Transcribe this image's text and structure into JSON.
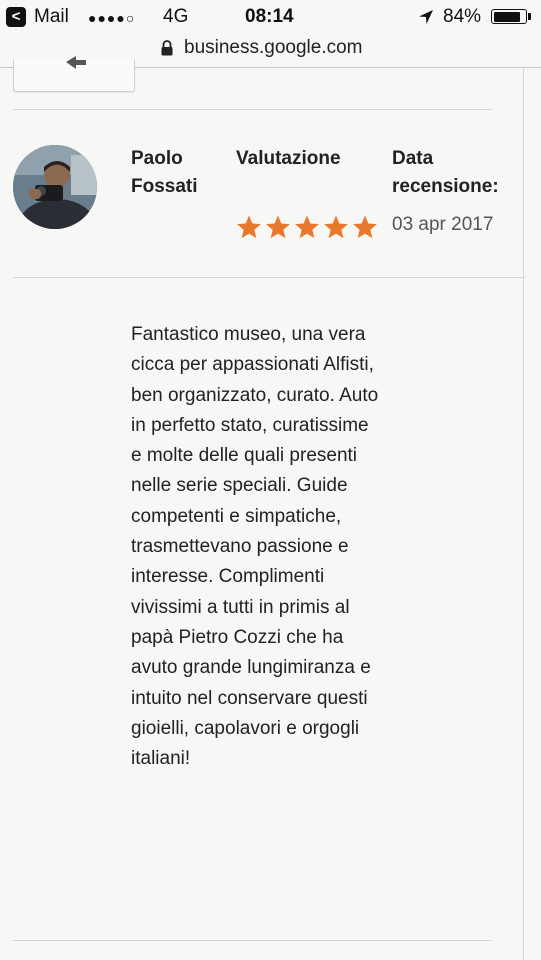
{
  "status_bar": {
    "back_glyph": "<",
    "app": "Mail",
    "signal": "●●●●○",
    "network": "4G",
    "time": "08:14",
    "battery": "84%",
    "battery_level": 0.84
  },
  "url_bar": {
    "url": "business.google.com",
    "icon": "lock-icon"
  },
  "review": {
    "author": "Paolo Fossati",
    "rating_label": "Valutazione",
    "date_label": "Data recensione:",
    "rating": 5,
    "rating_max": 5,
    "date": "03 apr 2017",
    "text": "Fantastico museo, una vera cicca per appassionati Alfisti, ben organizzato, curato. Auto in perfetto stato, curatissime e molte delle quali presenti nelle serie speciali. Guide competenti e simpatiche, trasmettevano passione e interesse. Complimenti vivissimi a tutti in primis al papà Pietro Cozzi che ha avuto grande lungimiranza e intuito nel conservare questi gioielli, capolavori e orgogli italiani!"
  },
  "colors": {
    "star": "#e8782c",
    "divider": "#d6d6d6",
    "text": "#222222",
    "muted": "#555555"
  }
}
